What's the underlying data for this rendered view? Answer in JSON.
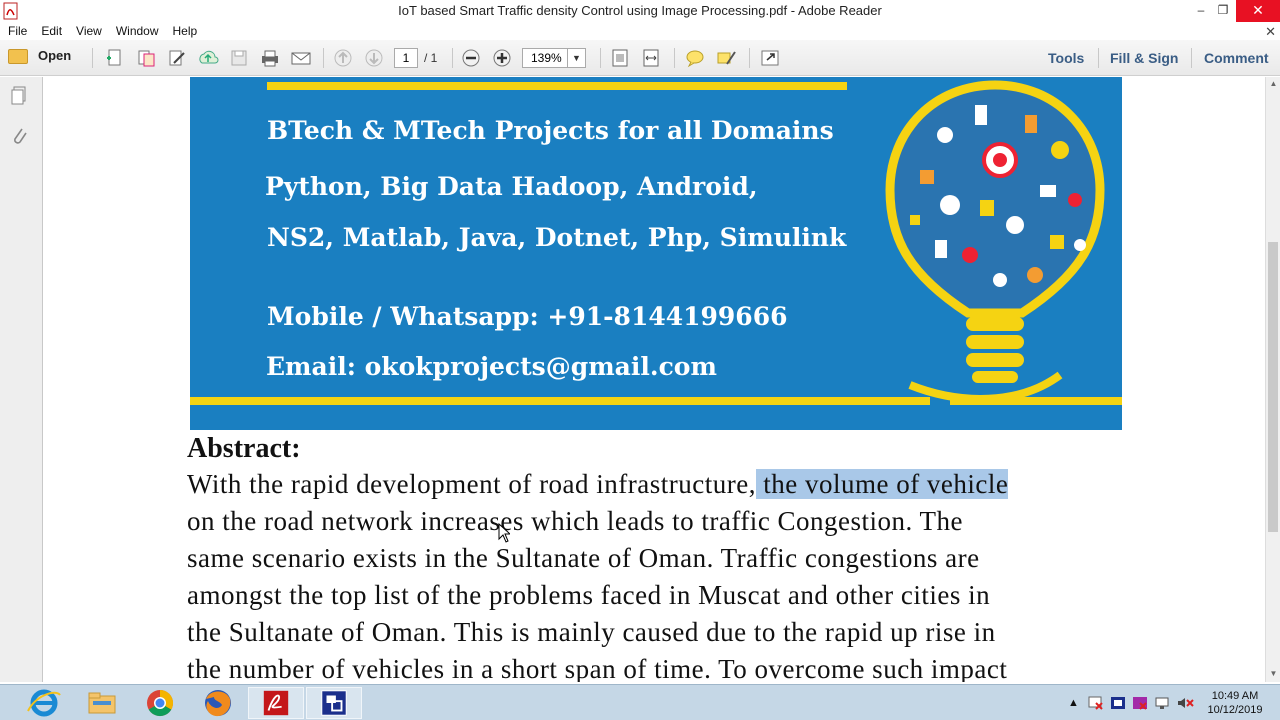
{
  "window": {
    "title": "IoT based Smart Traffic density Control using Image Processing.pdf - Adobe Reader",
    "minimize": "‒",
    "restore": "❐",
    "close": "✕"
  },
  "menu": {
    "items": [
      "File",
      "Edit",
      "View",
      "Window",
      "Help"
    ],
    "close_doc": "✕"
  },
  "toolbar": {
    "open_label": "Open",
    "page_current": "1",
    "page_total": "/ 1",
    "zoom": "139%",
    "tools_label": "Tools",
    "fill_sign_label": "Fill & Sign",
    "comment_label": "Comment"
  },
  "banner": {
    "line1": "BTech & MTech Projects for all Domains",
    "line2": "Python, Big Data Hadoop, Android,",
    "line3": "NS2, Matlab,  Java, Dotnet, Php, Simulink",
    "line4": "Mobile / Whatsapp: +91-8144199666",
    "line5": "Email:  okokprojects@gmail.com",
    "colors": {
      "background": "#1a7fc1",
      "accent": "#f5d312"
    }
  },
  "abstract": {
    "heading": "Abstract:",
    "line1_pre": "With the rapid development of road infrastructure,",
    "line1_highlight": " the volume of vehicle",
    "line2": "on the road network increases which leads to traffic Congestion. The",
    "line3": "same scenario exists in the Sultanate of Oman. Traffic congestions are",
    "line4": "amongst the top list of the problems faced in Muscat and other cities in",
    "line5": "the Sultanate of Oman. This is mainly caused due to the rapid up rise in",
    "line6": "the number of vehicles in a short span of time. To overcome such impact"
  },
  "taskbar": {
    "apps": [
      "internet-explorer-icon",
      "file-explorer-icon",
      "chrome-icon",
      "firefox-icon",
      "adobe-reader-icon",
      "remote-app-icon"
    ],
    "clock_time": "10:49 AM",
    "clock_date": "10/12/2019"
  }
}
